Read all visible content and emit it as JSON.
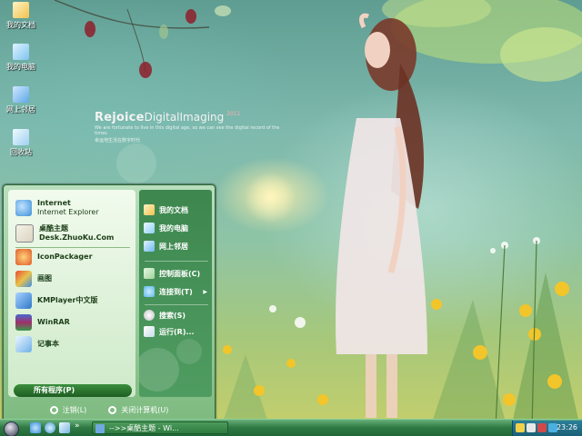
{
  "desktop": {
    "icons": [
      {
        "label": "我的文档",
        "icon": "documents-folder-icon",
        "color": "#f2c14e"
      },
      {
        "label": "我的电脑",
        "icon": "computer-icon",
        "color": "#7fc3ef"
      },
      {
        "label": "网上邻居",
        "icon": "network-icon",
        "color": "#5fa7e6"
      },
      {
        "label": "回收站",
        "icon": "recycle-bin-icon",
        "color": "#9fd0f0"
      }
    ],
    "watermark": {
      "title_bold": "Rejoice",
      "title_rest": "DigitalImaging",
      "year": "2011",
      "tagline_1": "We are fortunate to live in this digital age, so we can see the digital record of the times",
      "tagline_2": "幸运地生活在数字时代"
    }
  },
  "start_menu": {
    "pinned": [
      {
        "label": "Internet",
        "sub": "Internet Explorer",
        "icon": "internet-explorer-icon",
        "color": "#3d8fd8"
      },
      {
        "label": "桌酷主题Desk.ZhuoKu.Com",
        "sub": "",
        "icon": "zhuoku-app-icon",
        "color": "#d9d3c0"
      }
    ],
    "recent": [
      {
        "label": "IconPackager",
        "icon": "iconpackager-icon",
        "color": "#e05a2a"
      },
      {
        "label": "画图",
        "icon": "paint-icon",
        "color": "#e8c24a"
      },
      {
        "label": "KMPlayer中文版",
        "icon": "kmplayer-icon",
        "color": "#2f79c8"
      },
      {
        "label": "WinRAR",
        "icon": "winrar-icon",
        "color": "#a0306a"
      },
      {
        "label": "记事本",
        "icon": "notepad-icon",
        "color": "#6fb0e8"
      }
    ],
    "all_programs": "所有程序(P)",
    "right": [
      {
        "label": "我的文档",
        "icon": "my-documents-icon",
        "color": "#f2c14e"
      },
      {
        "label": "我的电脑",
        "icon": "my-computer-icon",
        "color": "#8fd0f5"
      },
      {
        "label": "网上邻居",
        "icon": "network-places-icon",
        "color": "#6fb8f0"
      },
      {
        "label": "控制面板(C)",
        "icon": "control-panel-icon",
        "color": "#9ed39a"
      },
      {
        "label": "连接到(T)",
        "icon": "connect-to-icon",
        "color": "#5fb6e8"
      },
      {
        "label": "搜索(S)",
        "icon": "search-icon",
        "color": "#e6e6e6"
      },
      {
        "label": "运行(R)...",
        "icon": "run-icon",
        "color": "#c9dbe8"
      }
    ],
    "logoff": "注销(L)",
    "shutdown": "关闭计算机(U)"
  },
  "taskbar": {
    "chevron": "»",
    "task_label": "-->>桌酷主题 - Wi...",
    "clock": "23:26"
  }
}
